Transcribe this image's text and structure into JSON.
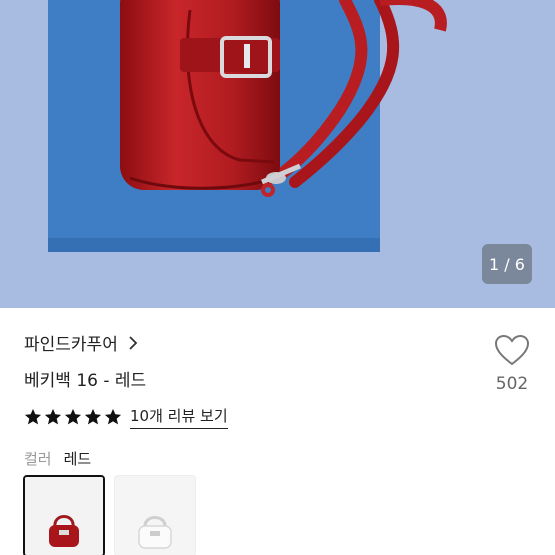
{
  "gallery": {
    "counter": "1 / 6"
  },
  "product": {
    "brand": "파인드카푸어",
    "title": "베키백 16 - 레드",
    "like_count": "502",
    "rating": 5,
    "review_link": "10개 리뷰 보기",
    "color_label": "컬러",
    "color_value": "레드"
  },
  "colors": {
    "red": "#b31b20",
    "blue_book": "#3d7cc3",
    "background": "#a7bbe0"
  },
  "swatches": [
    {
      "name": "red",
      "selected": true
    },
    {
      "name": "white",
      "selected": false
    }
  ]
}
